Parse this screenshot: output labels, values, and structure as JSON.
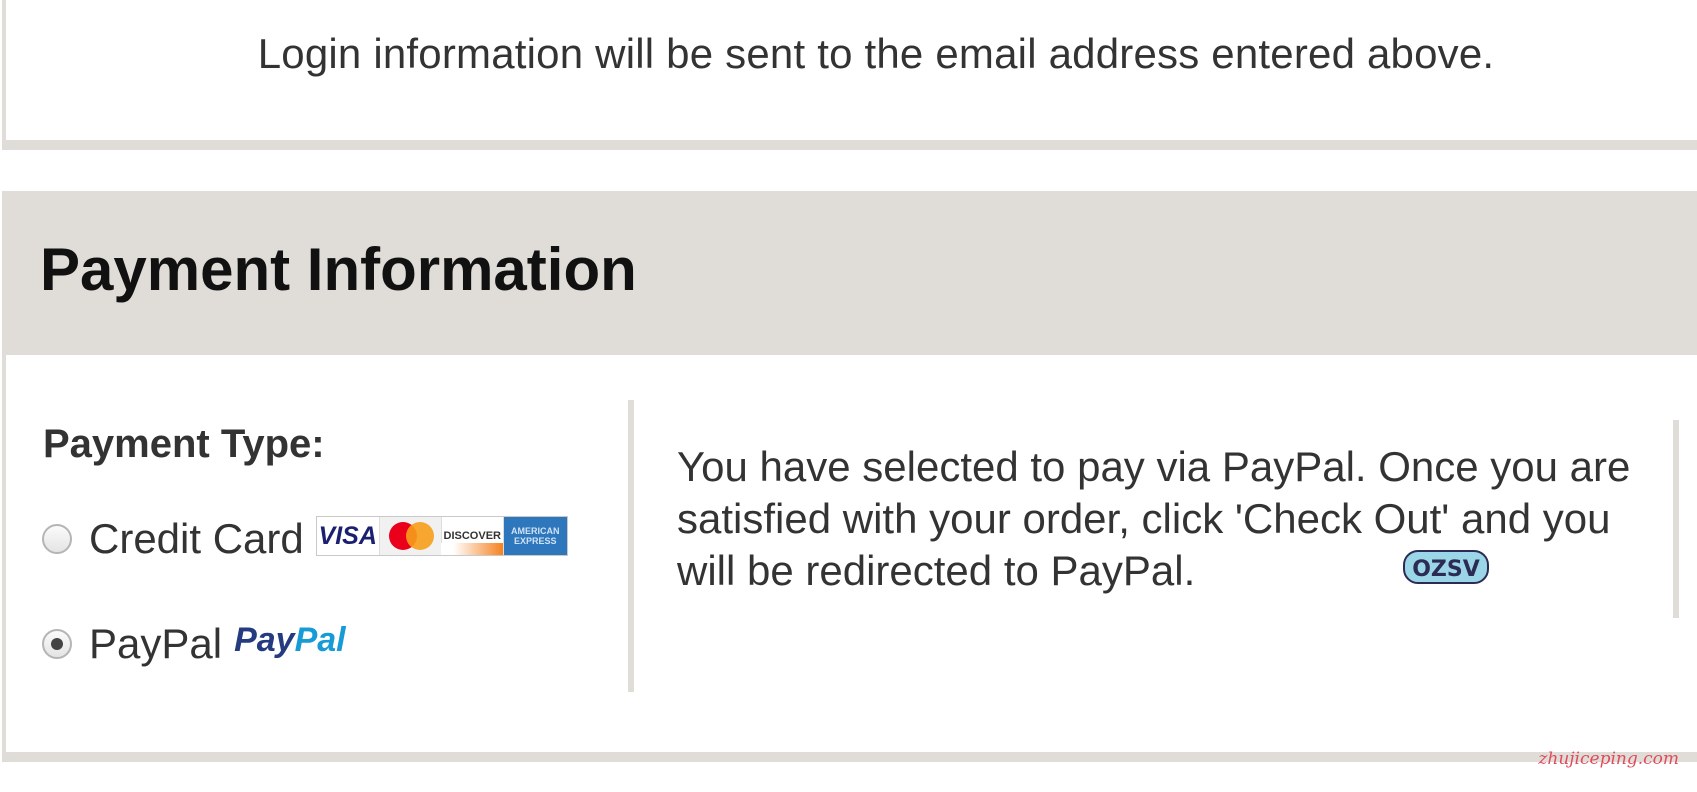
{
  "login_note": "Login information will be sent to the email address entered above.",
  "payment": {
    "title": "Payment Information",
    "type_label": "Payment Type:",
    "options": [
      {
        "label": "Credit Card",
        "selected": false,
        "logos": [
          "visa-logo",
          "mastercard-logo",
          "discover-logo",
          "amex-logo"
        ]
      },
      {
        "label": "PayPal",
        "selected": true,
        "logos": [
          "paypal-logo"
        ]
      }
    ],
    "card_logos": {
      "visa": "VISA",
      "discover": "DISCOVER",
      "amex": "AMERICAN EXPRESS"
    },
    "paypal_logo": {
      "part1": "Pay",
      "part2": "Pal"
    },
    "paypal_message": "You have selected to pay via PayPal. Once you are satisfied with your order, click 'Check Out' and you will be redirected to PayPal."
  },
  "watermarks": {
    "badge": "OZSV",
    "site": "zhujiceping.com"
  },
  "colors": {
    "panel_gray": "#e0dcd7",
    "text": "#333333",
    "paypal_dark": "#253b80",
    "paypal_light": "#179bd7"
  }
}
